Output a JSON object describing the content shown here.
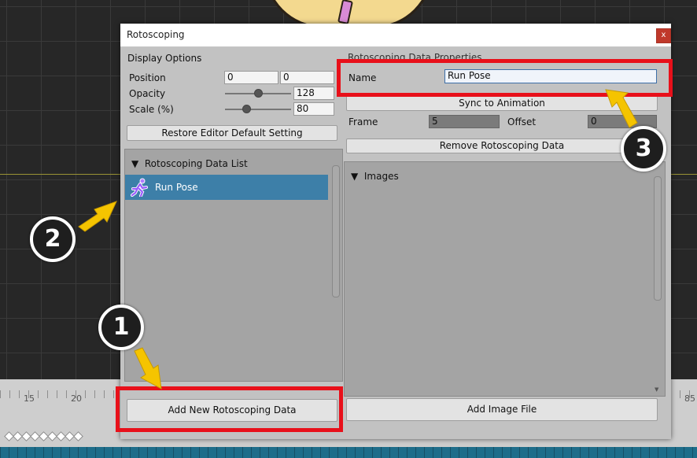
{
  "dialog": {
    "title": "Rotoscoping",
    "close_label": "x"
  },
  "display_options": {
    "header": "Display Options",
    "position_label": "Position",
    "position_x": "0",
    "position_y": "0",
    "opacity_label": "Opacity",
    "opacity_value": "128",
    "opacity_level": 0.5,
    "scale_label": "Scale (%)",
    "scale_value": "80",
    "scale_level": 0.32,
    "restore_button": "Restore Editor Default Setting"
  },
  "data_list": {
    "header": "Rotoscoping Data List",
    "items": [
      {
        "label": "Run Pose",
        "icon": "running-figure-icon",
        "selected": true
      }
    ],
    "add_button": "Add New Rotoscoping Data"
  },
  "properties": {
    "header": "Rotoscoping Data Properties",
    "name_label": "Name",
    "name_value": "Run Pose",
    "sync_button": "Sync to Animation",
    "frame_label": "Frame",
    "frame_value": "5",
    "offset_label": "Offset",
    "offset_value": "0",
    "remove_button": "Remove Rotoscoping Data"
  },
  "images": {
    "header": "Images",
    "add_button": "Add Image File"
  },
  "timeline": {
    "tick_labels": [
      "15",
      "20",
      "85"
    ]
  },
  "annotations": {
    "badge_1": "1",
    "badge_2": "2",
    "badge_3": "3",
    "highlight_color": "#e8101a",
    "arrow_color": "#f5c400"
  }
}
